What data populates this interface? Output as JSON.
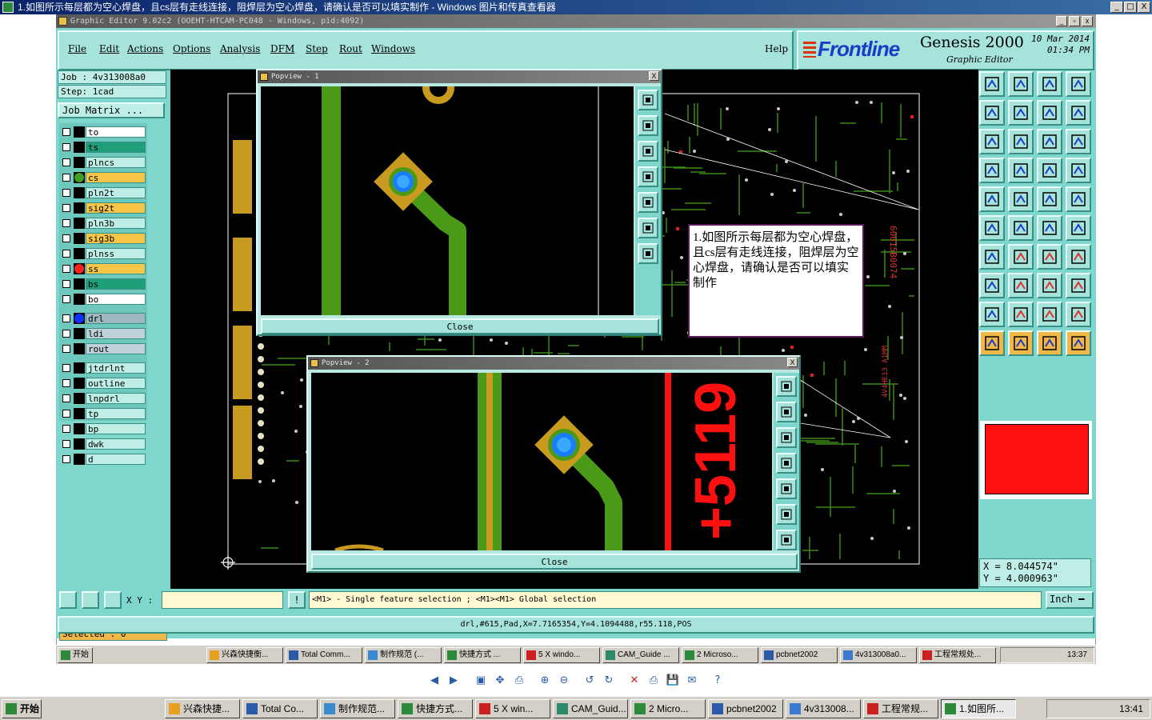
{
  "outer_window": {
    "title": "1.如图所示每层都为空心焊盘，且cs层有走线连接，阻焊层为空心焊盘，请确认是否可以填实制作 - Windows 图片和传真查看器",
    "controls": [
      "_",
      "□",
      "X"
    ]
  },
  "genesis": {
    "title": "Graphic Editor 9.02c2 (OOEHT-HTCAM-PC048 - Windows, pid:4092)",
    "menu": [
      "File",
      "Edit",
      "Actions",
      "Options",
      "Analysis",
      "DFM",
      "Step",
      "Rout",
      "Windows"
    ],
    "help": "Help",
    "brand": {
      "logo": "Frontline",
      "product": "Genesis 2000",
      "subtitle": "Graphic Editor",
      "date": "10 Mar 2014",
      "time": "01:34 PM"
    },
    "job": "Job : 4v313008a0",
    "step": "Step: 1cad",
    "job_matrix": "Job Matrix ...",
    "layers": [
      {
        "name": "to",
        "color": "#ffffff",
        "dot": ""
      },
      {
        "name": "ts",
        "color": "#1f9e7a",
        "dot": ""
      },
      {
        "name": "plncs",
        "color": "#bfeee6",
        "dot": ""
      },
      {
        "name": "cs",
        "color": "#f7c548",
        "dot": "#3fa020"
      },
      {
        "name": "pln2t",
        "color": "#bfeee6",
        "dot": ""
      },
      {
        "name": "sig2t",
        "color": "#f7c548",
        "dot": ""
      },
      {
        "name": "pln3b",
        "color": "#bfeee6",
        "dot": ""
      },
      {
        "name": "sig3b",
        "color": "#f7c548",
        "dot": ""
      },
      {
        "name": "plnss",
        "color": "#bfeee6",
        "dot": ""
      },
      {
        "name": "ss",
        "color": "#f7c548",
        "dot": "#ff2020"
      },
      {
        "name": "bs",
        "color": "#1f9e7a",
        "dot": ""
      },
      {
        "name": "bo",
        "color": "#ffffff",
        "dot": ""
      },
      {
        "name": "drl",
        "color": "#9fb8c0",
        "dot": "#1030ff"
      },
      {
        "name": "ldi",
        "color": "#bfd0d8",
        "dot": ""
      },
      {
        "name": "rout",
        "color": "#bfd0d8",
        "dot": ""
      },
      {
        "name": "jtdrlnt",
        "color": "#bfeee6",
        "dot": ""
      },
      {
        "name": "outline",
        "color": "#bfeee6",
        "dot": ""
      },
      {
        "name": "lnpdrl",
        "color": "#bfeee6",
        "dot": ""
      },
      {
        "name": "tp",
        "color": "#bfeee6",
        "dot": ""
      },
      {
        "name": "bp",
        "color": "#bfeee6",
        "dot": ""
      },
      {
        "name": "dwk",
        "color": "#bfeee6",
        "dot": ""
      },
      {
        "name": "d",
        "color": "#bfeee6",
        "dot": ""
      }
    ],
    "selected": "Selected : 0",
    "xy_label": "X Y :",
    "xy_value": "",
    "bang": "!",
    "prompt": "<M1> - Single feature selection ; <M1><M1> Global selection",
    "units": "Inch",
    "feature_info": "drl,#615,Pad,X=7.7165354,Y=4.1094488,r55.118,POS",
    "coords": {
      "x": "X  =  8.044574\"",
      "y": "Y  =  4.000963\""
    },
    "board_text_1": "60015B0074",
    "board_text_2": "4V4HE13 A1MM"
  },
  "popview1": {
    "title": "Popview - 1",
    "close": "Close"
  },
  "popview2": {
    "title": "Popview - 2",
    "close": "Close",
    "silk_text": "+5119"
  },
  "note": "1.如图所示每层都为空心焊盘，且cs层有走线连接，阻焊层为空心焊盘，请确认是否可以填实制作",
  "inner_taskbar": {
    "start": "开始",
    "items": [
      "兴森快捷衡...",
      "Total Comm...",
      "制作规范 (...",
      "快捷方式 ...",
      "5 X windo...",
      "CAM_Guide ...",
      "2 Microso...",
      "pcbnet2002",
      "4v313008a0...",
      "工程常规处..."
    ],
    "time": "13:37"
  },
  "outer_taskbar": {
    "start": "开始",
    "items": [
      "兴森快捷...",
      "Total Co...",
      "制作规范...",
      "快捷方式...",
      "5 X win...",
      "CAM_Guid...",
      "2 Micro...",
      "pcbnet2002",
      "4v313008...",
      "工程常规...",
      "1.如图所..."
    ],
    "time": "13:41"
  },
  "viewer_toolbar": [
    "◀",
    "▶",
    "▣",
    "✥",
    "⎙",
    "⊕",
    "⊖",
    "↺",
    "↻",
    "✕",
    "⎙",
    "💾",
    "✉",
    "?"
  ]
}
